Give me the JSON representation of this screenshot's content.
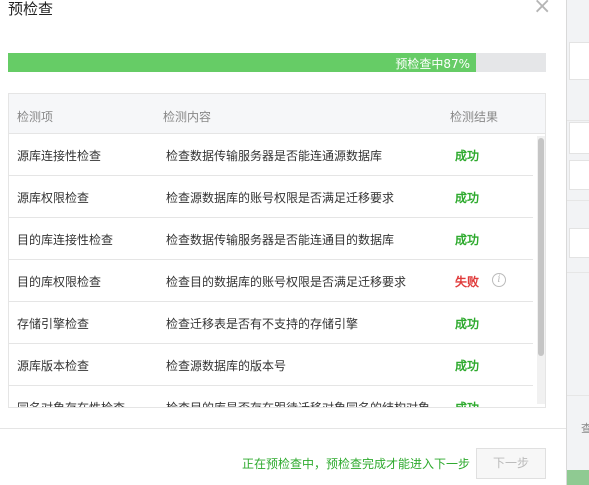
{
  "dialog": {
    "title": "预检查",
    "close_label": "×"
  },
  "progress": {
    "value": 0.87,
    "label": "预检查中87%"
  },
  "table": {
    "headers": [
      "检测项",
      "检测内容",
      "检测结果"
    ],
    "rows": [
      {
        "item": "源库连接性检查",
        "content": "检查数据传输服务器是否能连通源数据库",
        "result": "成功",
        "status": "success"
      },
      {
        "item": "源库权限检查",
        "content": "检查源数据库的账号权限是否满足迁移要求",
        "result": "成功",
        "status": "success"
      },
      {
        "item": "目的库连接性检查",
        "content": "检查数据传输服务器是否能连通目的数据库",
        "result": "成功",
        "status": "success"
      },
      {
        "item": "目的库权限检查",
        "content": "检查目的数据库的账号权限是否满足迁移要求",
        "result": "失败",
        "status": "fail",
        "info_icon": "info-icon"
      },
      {
        "item": "存储引擎检查",
        "content": "检查迁移表是否有不支持的存储引擎",
        "result": "成功",
        "status": "success"
      },
      {
        "item": "源库版本检查",
        "content": "检查源数据库的版本号",
        "result": "成功",
        "status": "success"
      },
      {
        "item": "同名对象存在性检查",
        "content": "检查目的库是否存在跟待迁移对象同名的结构对象",
        "result": "成功",
        "status": "success"
      }
    ]
  },
  "footer": {
    "message": "正在预检查中，预检查完成才能进入下一步",
    "next_label": "下一步"
  },
  "colors": {
    "success": "#2eaa2e",
    "fail": "#e03b3b",
    "progress_fill": "#66cc66",
    "progress_track": "#e5e6e8"
  }
}
